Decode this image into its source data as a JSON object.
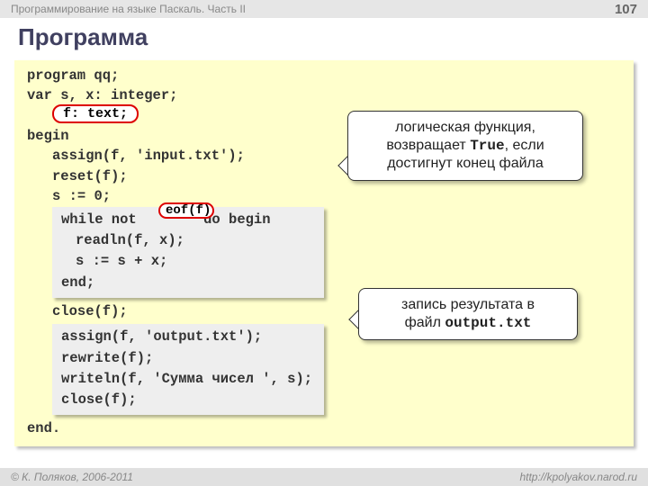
{
  "header": {
    "breadcrumb": "Программирование на языке Паскаль. Часть II",
    "page_number": "107"
  },
  "title": "Программа",
  "code": {
    "l1": "program qq;",
    "l2": "var s, x: integer;",
    "pill_f": "f: text;",
    "l4": "begin",
    "l5": "assign(f, 'input.txt');",
    "l6": "reset(f);",
    "l7": "s := 0;",
    "box1": {
      "eof": "eof(f)",
      "b1": "while not        do begin",
      "b2": "readln(f, x);",
      "b3": "s := s + x;",
      "b4": "end;"
    },
    "l8": "close(f);",
    "box2": {
      "c1": "assign(f, 'output.txt');",
      "c2": "rewrite(f);",
      "c3": "writeln(f, 'Сумма чисел ', s);",
      "c4": "close(f);"
    },
    "l9": "end."
  },
  "callouts": {
    "c1_a": "логическая функция,",
    "c1_b_pre": "возвращает ",
    "c1_b_mono": "True",
    "c1_b_post": ", если",
    "c1_c": "достигнут конец файла",
    "c2_a": "запись результата в",
    "c2_b_pre": "файл ",
    "c2_b_mono": "output.txt"
  },
  "footer": {
    "left": "© К. Поляков, 2006-2011",
    "right": "http://kpolyakov.narod.ru"
  }
}
